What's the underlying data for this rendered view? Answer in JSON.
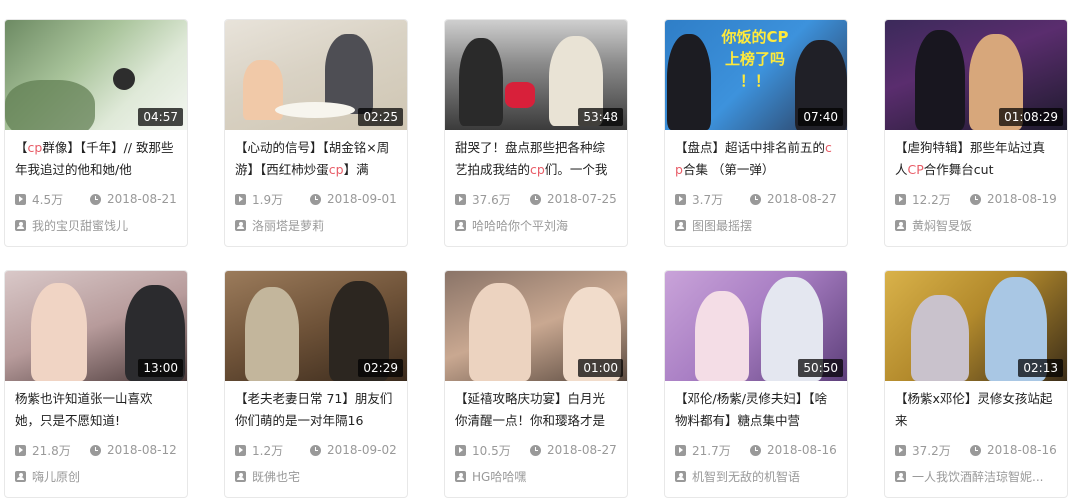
{
  "cards": [
    {
      "duration": "04:57",
      "title_parts": [
        "【",
        "cp",
        "群像】【千年】// 致那些年我追过的他和她/他"
      ],
      "views": "4.5万",
      "date": "2018-08-21",
      "author": "我的宝贝甜蜜饯儿"
    },
    {
      "duration": "02:25",
      "title_parts": [
        "【心动的信号】【胡金铭×周游】【西红柿炒蛋",
        "cp",
        "】满"
      ],
      "views": "1.9万",
      "date": "2018-09-01",
      "author": "洛丽塔是萝莉"
    },
    {
      "duration": "53:48",
      "title_parts": [
        "甜哭了！盘点那些把各种综艺拍成我结的",
        "cp",
        "们。一个我"
      ],
      "views": "37.6万",
      "date": "2018-07-25",
      "author": "哈哈哈你个平刘海"
    },
    {
      "duration": "07:40",
      "overlay": "你饭的CP 上榜了吗 ！！",
      "title_parts": [
        "【盘点】超话中排名前五的",
        "cp",
        "合集 （第一弹）"
      ],
      "views": "3.7万",
      "date": "2018-08-27",
      "author": "图图最摇摆"
    },
    {
      "duration": "01:08:29",
      "title_parts": [
        "【虐狗特辑】那些年站过真人",
        "CP",
        "合作舞台cut"
      ],
      "views": "12.2万",
      "date": "2018-08-19",
      "author": "黄焖智旻饭"
    },
    {
      "duration": "13:00",
      "title_parts": [
        "杨紫也许知道张一山喜欢她，只是不愿知道!",
        "",
        ""
      ],
      "views": "21.8万",
      "date": "2018-08-12",
      "author": "嗨儿原创"
    },
    {
      "duration": "02:29",
      "title_parts": [
        "【老夫老妻日常 71】朋友们 你们萌的是一对年隔16",
        "",
        ""
      ],
      "views": "1.2万",
      "date": "2018-09-02",
      "author": "既佛也宅"
    },
    {
      "duration": "01:00",
      "title_parts": [
        "【延禧攻略庆功宴】白月光你清醒一点！你和璎珞才是",
        "",
        ""
      ],
      "views": "10.5万",
      "date": "2018-08-27",
      "author": "HG哈哈嘿"
    },
    {
      "duration": "50:50",
      "title_parts": [
        "【邓伦/杨紫/灵修夫妇】【啥物料都有】糖点集中营",
        "",
        ""
      ],
      "views": "21.7万",
      "date": "2018-08-16",
      "author": "机智到无敌的机智语"
    },
    {
      "duration": "02:13",
      "title_parts": [
        "【杨紫x邓伦】灵修女孩站起来",
        "",
        ""
      ],
      "views": "37.2万",
      "date": "2018-08-16",
      "author": "一人我饮酒醉洁琼智妮..."
    }
  ]
}
